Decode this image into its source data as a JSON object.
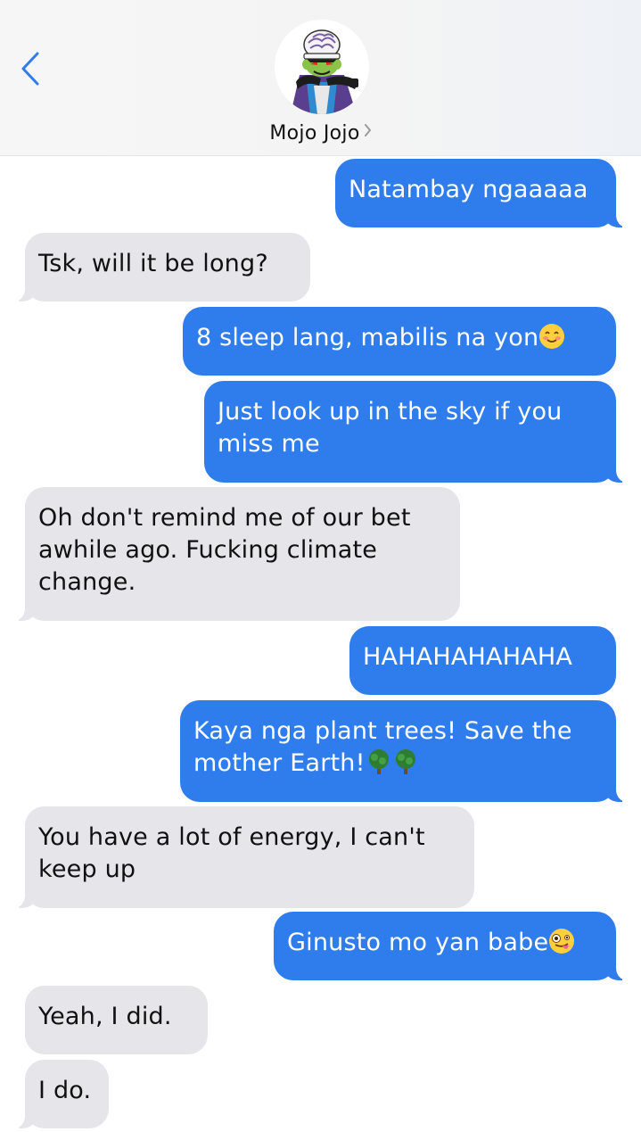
{
  "header": {
    "contact_name": "Mojo Jojo",
    "back_icon": "chevron-left-icon",
    "detail_icon": "chevron-right-icon"
  },
  "colors": {
    "outgoing_bubble": "#2f7dec",
    "incoming_bubble": "#e5e5ea",
    "accent": "#2f7dec"
  },
  "messages": [
    {
      "direction": "outgoing",
      "text": "Natambay ngaaaaa"
    },
    {
      "direction": "incoming",
      "text": "Tsk, will it be long?"
    },
    {
      "direction": "outgoing",
      "text": "8 sleep lang, mabilis na yon",
      "emoji": "smiling-blush-emoji"
    },
    {
      "direction": "outgoing",
      "line1": "Just look up in the sky if you",
      "line2": "miss me"
    },
    {
      "direction": "incoming",
      "line1": "Oh don't remind me of our bet",
      "line2": "awhile ago. Fucking climate",
      "line3": "change."
    },
    {
      "direction": "outgoing",
      "text": "HAHAHAHAHAHA"
    },
    {
      "direction": "outgoing",
      "line1": "Kaya nga plant trees! Save the",
      "line2": "mother Earth!",
      "emoji": "tree-emoji"
    },
    {
      "direction": "incoming",
      "line1": "You have a lot of energy, I can't",
      "line2": "keep up"
    },
    {
      "direction": "outgoing",
      "text": "Ginusto mo yan babe",
      "emoji": "zany-face-emoji"
    },
    {
      "direction": "incoming",
      "text": "Yeah, I did."
    },
    {
      "direction": "incoming",
      "text": "I do."
    }
  ]
}
